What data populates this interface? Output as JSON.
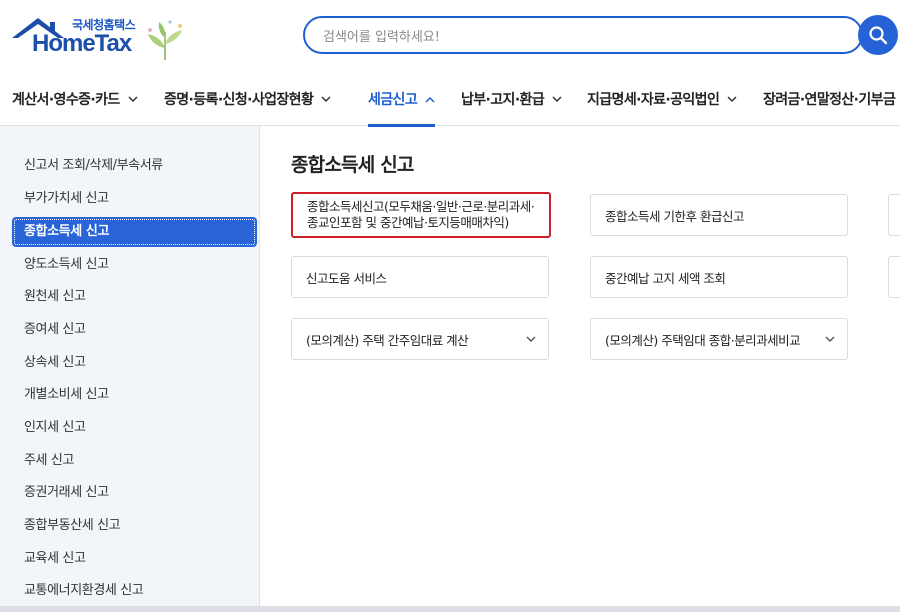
{
  "brand": {
    "sub_title": "국세청홈택스",
    "main_title": "HomeTax"
  },
  "search": {
    "placeholder": "검색어를 입력하세요!"
  },
  "nav": [
    {
      "label": "계산서·영수증·카드"
    },
    {
      "label": "증명·등록·신청·사업장현황"
    },
    {
      "label": "세금신고"
    },
    {
      "label": "납부·고지·환급"
    },
    {
      "label": "지급명세·자료·공익법인"
    },
    {
      "label": "장려금·연말정산·기부금"
    }
  ],
  "sidebar": {
    "items": [
      {
        "label": "신고서 조회/삭제/부속서류"
      },
      {
        "label": "부가가치세 신고"
      },
      {
        "label": "종합소득세 신고"
      },
      {
        "label": "양도소득세 신고"
      },
      {
        "label": "원천세 신고"
      },
      {
        "label": "증여세 신고"
      },
      {
        "label": "상속세 신고"
      },
      {
        "label": "개별소비세 신고"
      },
      {
        "label": "인지세 신고"
      },
      {
        "label": "주세 신고"
      },
      {
        "label": "증권거래세 신고"
      },
      {
        "label": "종합부동산세 신고"
      },
      {
        "label": "교육세 신고"
      },
      {
        "label": "교통에너지환경세 신고"
      }
    ],
    "active_index": 2
  },
  "main": {
    "title": "종합소득세 신고",
    "cards": [
      {
        "label": "종합소득세신고(모두채움·일반·근로·분리과세·종교인포함 및 중간예납·토지등매매차익)"
      },
      {
        "label": "종합소득세 기한후 환급신고"
      },
      {
        "label": "신고도움 서비스"
      },
      {
        "label": "중간예납 고지 세액 조회"
      },
      {
        "label": "(모의계산) 주택 간주임대료 계산"
      },
      {
        "label": "(모의계산) 주택임대 종합·분리과세비교"
      }
    ]
  },
  "colors": {
    "brand_blue": "#1d5fd0",
    "active_sidebar": "#2965d8",
    "highlight_red": "#cc1f27"
  }
}
